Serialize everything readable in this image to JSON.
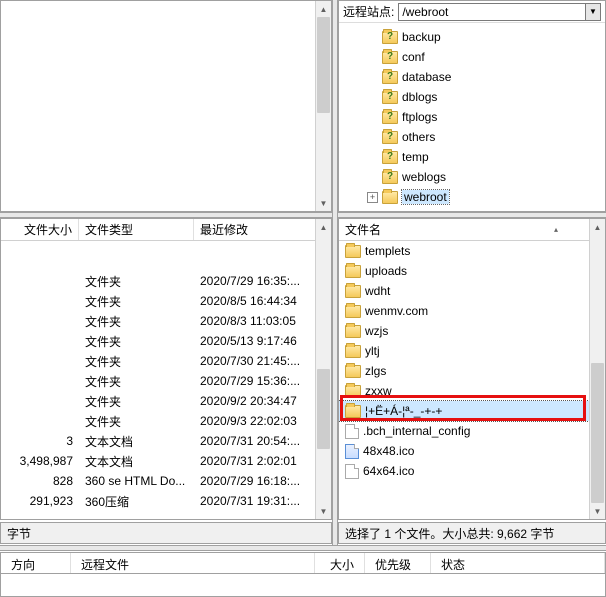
{
  "remote_addr": {
    "label": "远程站点:",
    "path": "/webroot"
  },
  "tree": {
    "items": [
      {
        "name": "backup",
        "type": "q"
      },
      {
        "name": "conf",
        "type": "q"
      },
      {
        "name": "database",
        "type": "q"
      },
      {
        "name": "dblogs",
        "type": "q"
      },
      {
        "name": "ftplogs",
        "type": "q"
      },
      {
        "name": "others",
        "type": "q"
      },
      {
        "name": "temp",
        "type": "q"
      },
      {
        "name": "weblogs",
        "type": "q"
      },
      {
        "name": "webroot",
        "type": "exp"
      }
    ]
  },
  "local_list": {
    "headers": {
      "size": "文件大小",
      "type": "文件类型",
      "modified": "最近修改"
    },
    "rows": [
      {
        "size": "",
        "type": "文件夹",
        "modified": "2020/7/29 16:35:..."
      },
      {
        "size": "",
        "type": "文件夹",
        "modified": "2020/8/5 16:44:34"
      },
      {
        "size": "",
        "type": "文件夹",
        "modified": "2020/8/3 11:03:05"
      },
      {
        "size": "",
        "type": "文件夹",
        "modified": "2020/5/13 9:17:46"
      },
      {
        "size": "",
        "type": "文件夹",
        "modified": "2020/7/30 21:45:..."
      },
      {
        "size": "",
        "type": "文件夹",
        "modified": "2020/7/29 15:36:..."
      },
      {
        "size": "",
        "type": "文件夹",
        "modified": "2020/9/2 20:34:47"
      },
      {
        "size": "",
        "type": "文件夹",
        "modified": "2020/9/3 22:02:03"
      },
      {
        "size": "3",
        "type": "文本文档",
        "modified": "2020/7/31 20:54:..."
      },
      {
        "size": "3,498,987",
        "type": "文本文档",
        "modified": "2020/7/31 2:02:01"
      },
      {
        "size": "828",
        "type": "360 se HTML Do...",
        "modified": "2020/7/29 16:18:..."
      },
      {
        "size": "291,923",
        "type": "360压缩",
        "modified": "2020/7/31 19:31:..."
      }
    ]
  },
  "remote_list": {
    "header": "文件名",
    "rows": [
      {
        "name": "templets",
        "icon": "folder"
      },
      {
        "name": "uploads",
        "icon": "folder"
      },
      {
        "name": "wdht",
        "icon": "folder"
      },
      {
        "name": "wenmv.com",
        "icon": "folder"
      },
      {
        "name": "wzjs",
        "icon": "folder"
      },
      {
        "name": "yltj",
        "icon": "folder"
      },
      {
        "name": "zlgs",
        "icon": "folder"
      },
      {
        "name": "zxxw",
        "icon": "folder"
      },
      {
        "name": "¦+Ë+Á-¦ª-_-+-+",
        "icon": "folder",
        "selected": true
      },
      {
        "name": ".bch_internal_config",
        "icon": "file"
      },
      {
        "name": "48x48.ico",
        "icon": "ico"
      },
      {
        "name": "64x64.ico",
        "icon": "file"
      }
    ]
  },
  "status_left": "字节",
  "status_right": "选择了 1 个文件。大小总共: 9,662 字节",
  "bottom_headers": {
    "direction": "方向",
    "remote": "远程文件",
    "size": "大小",
    "priority": "优先级",
    "status": "状态"
  }
}
